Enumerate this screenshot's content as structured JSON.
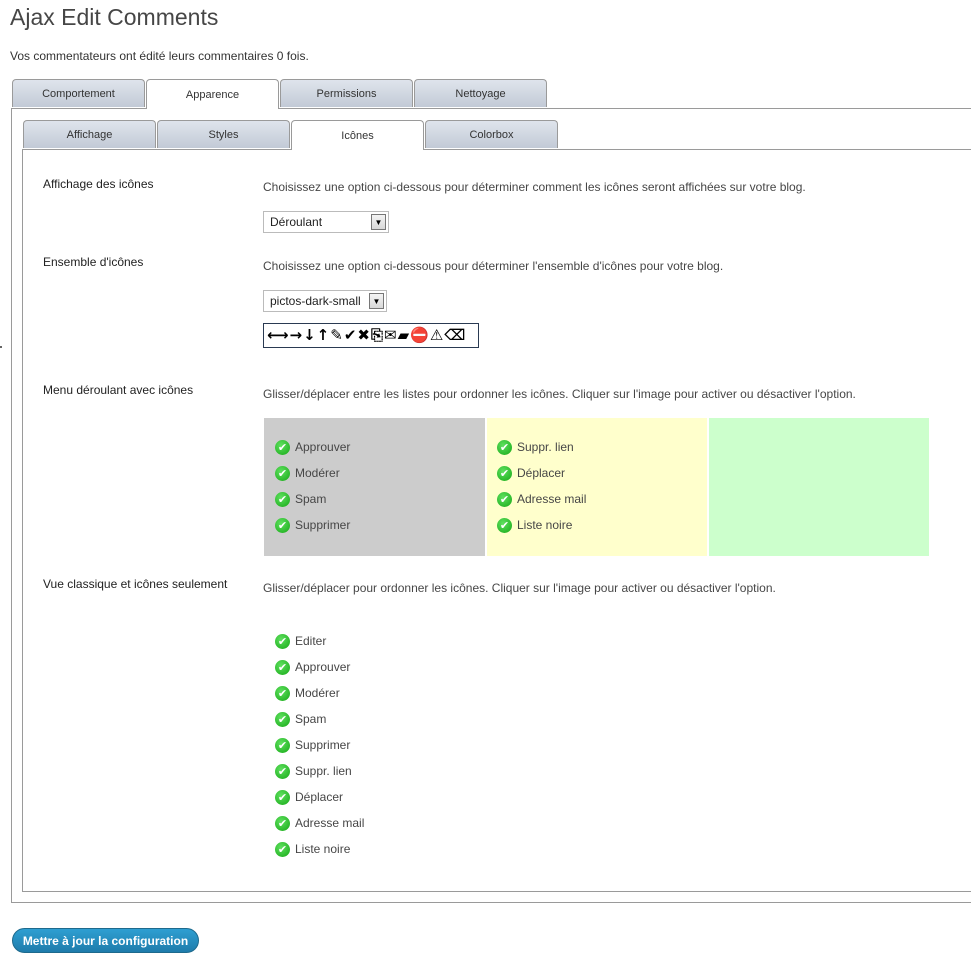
{
  "page": {
    "title": "Ajax Edit Comments",
    "subtitle": "Vos commentateurs ont édité leurs commentaires 0 fois."
  },
  "outer_tabs": [
    {
      "label": "Comportement",
      "active": false
    },
    {
      "label": "Apparence",
      "active": true
    },
    {
      "label": "Permissions",
      "active": false
    },
    {
      "label": "Nettoyage",
      "active": false
    }
  ],
  "inner_tabs": [
    {
      "label": "Affichage",
      "active": false
    },
    {
      "label": "Styles",
      "active": false
    },
    {
      "label": "Icônes",
      "active": true
    },
    {
      "label": "Colorbox",
      "active": false
    }
  ],
  "sections": {
    "icon_display": {
      "label": "Affichage des icônes",
      "description": "Choisissez une option ci-dessous pour déterminer comment les icônes seront affichées sur votre blog.",
      "selected": "Déroulant"
    },
    "icon_set": {
      "label": "Ensemble d'icônes",
      "description": "Choisissez une option ci-dessous pour déterminer l'ensemble d'icônes pour votre blog.",
      "selected": "pictos-dark-small",
      "preview_glyphs": [
        "⟷",
        "→",
        "↓",
        "↑",
        "✎",
        "✔",
        "✖",
        "⎘",
        "✉",
        "▰",
        "⛔",
        "⚠",
        "⌫"
      ]
    },
    "dropdown_menu": {
      "label": "Menu déroulant avec icônes",
      "description": "Glisser/déplacer entre les listes pour ordonner les icônes. Cliquer sur l'image pour activer ou désactiver l'option.",
      "list_gray": [
        "Approuver",
        "Modérer",
        "Spam",
        "Supprimer"
      ],
      "list_yellow": [
        "Suppr. lien",
        "Déplacer",
        "Adresse mail",
        "Liste noire"
      ],
      "list_green": [],
      "colors": {
        "gray": "#cccccc",
        "yellow": "#ffffcc",
        "green": "#ccffcc"
      }
    },
    "classic_view": {
      "label": "Vue classique et icônes seulement",
      "description": "Glisser/déplacer pour ordonner les icônes. Cliquer sur l'image pour activer ou désactiver l'option.",
      "list": [
        "Editer",
        "Approuver",
        "Modérer",
        "Spam",
        "Supprimer",
        "Suppr. lien",
        "Déplacer",
        "Adresse mail",
        "Liste noire"
      ]
    }
  },
  "update_button": "Mettre à jour la configuration",
  "colors": {
    "check": "#1fb11f",
    "button": "#2382b5"
  }
}
